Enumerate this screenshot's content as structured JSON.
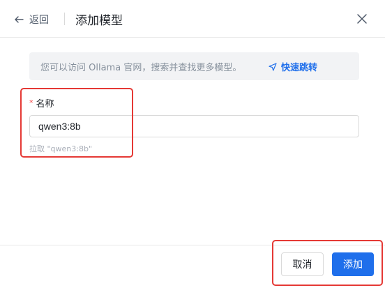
{
  "header": {
    "back_label": "返回",
    "title": "添加模型"
  },
  "info": {
    "text": "您可以访问 Ollama 官网，搜索并查找更多模型。",
    "link_label": "快速跳转"
  },
  "form": {
    "required_mark": "*",
    "name_label": "名称",
    "name_value": "qwen3:8b",
    "hint": "拉取 \"qwen3:8b\""
  },
  "footer": {
    "cancel_label": "取消",
    "add_label": "添加"
  },
  "colors": {
    "accent": "#1f6feb",
    "highlight": "#e53935",
    "required": "#f53f3f"
  },
  "icons": [
    "back-arrow-icon",
    "close-icon",
    "navigation-arrow-icon"
  ]
}
